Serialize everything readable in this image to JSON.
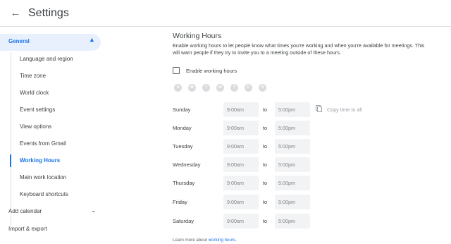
{
  "header": {
    "back_icon": "arrow-back-icon",
    "title": "Settings"
  },
  "sidebar": {
    "general": {
      "label": "General",
      "expanded": true,
      "chevron_icon": "chevron-up-icon"
    },
    "sub_items": [
      {
        "label": "Language and region",
        "active": false
      },
      {
        "label": "Time zone",
        "active": false
      },
      {
        "label": "World clock",
        "active": false
      },
      {
        "label": "Event settings",
        "active": false
      },
      {
        "label": "View options",
        "active": false
      },
      {
        "label": "Events from Gmail",
        "active": false
      },
      {
        "label": "Working Hours",
        "active": true
      },
      {
        "label": "Main work location",
        "active": false
      },
      {
        "label": "Keyboard shortcuts",
        "active": false
      }
    ],
    "add_calendar": {
      "label": "Add calendar",
      "chevron_icon": "chevron-down-icon"
    },
    "import_export": {
      "label": "Import & export"
    }
  },
  "main": {
    "title": "Working Hours",
    "description": "Enable working hours to let people know what times you're working and when you're available for meetings. This will warn people if they try to invite you to a meeting outside of these hours.",
    "enable_checkbox": {
      "label": "Enable working hours",
      "checked": false
    },
    "day_chips": [
      "S",
      "M",
      "T",
      "W",
      "T",
      "F",
      "S"
    ],
    "schedule": [
      {
        "day": "Sunday",
        "start": "9:00am",
        "to": "to",
        "end": "5:00pm"
      },
      {
        "day": "Monday",
        "start": "9:00am",
        "to": "to",
        "end": "5:00pm"
      },
      {
        "day": "Tuesday",
        "start": "9:00am",
        "to": "to",
        "end": "5:00pm"
      },
      {
        "day": "Wednesday",
        "start": "9:00am",
        "to": "to",
        "end": "5:00pm"
      },
      {
        "day": "Thursday",
        "start": "9:00am",
        "to": "to",
        "end": "5:00pm"
      },
      {
        "day": "Friday",
        "start": "9:00am",
        "to": "to",
        "end": "5:00pm"
      },
      {
        "day": "Saturday",
        "start": "9:00am",
        "to": "to",
        "end": "5:00pm"
      }
    ],
    "copy_all": {
      "label": "Copy time to all",
      "icon": "copy-icon"
    },
    "learn_more": {
      "prefix": "Learn more about ",
      "link": "working hours",
      "suffix": "."
    }
  },
  "colors": {
    "accent": "#1a73e8",
    "active_bg": "#e8f0fe",
    "field_bg": "#f1f3f4",
    "disabled_chip": "#dadce0"
  }
}
